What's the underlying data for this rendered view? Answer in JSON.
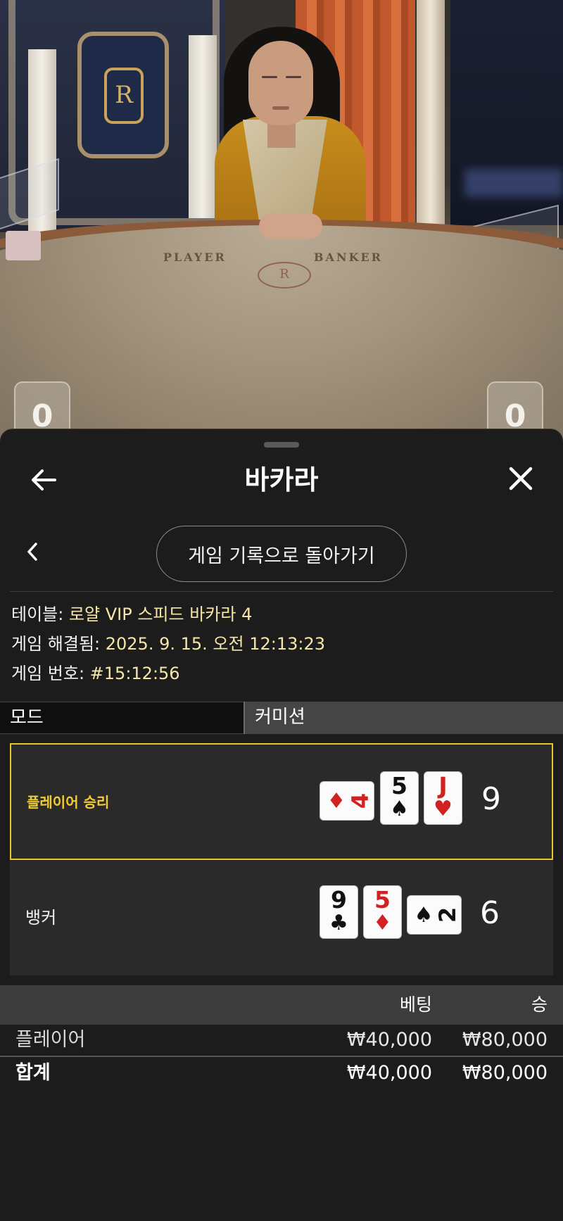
{
  "video": {
    "felt_player": "PLAYER",
    "felt_banker": "BANKER",
    "player_score": "0",
    "banker_score": "0"
  },
  "header": {
    "title": "바카라",
    "back_icon": "arrow-left-icon",
    "close_icon": "close-x-icon"
  },
  "nav": {
    "back_to_history": "게임 기록으로 돌아가기",
    "prev_icon": "chevron-left-icon"
  },
  "info": {
    "table_label": "테이블: ",
    "table_value": "로얄 VIP 스피드 바카라 4",
    "resolved_label": "게임 해결됨: ",
    "resolved_value": "2025. 9. 15. 오전 12:13:23",
    "number_label": "게임 번호: ",
    "number_value": "#15:12:56"
  },
  "tabs": {
    "mode": "모드",
    "commission": "커미션"
  },
  "results": {
    "player": {
      "label": "플레이어 승리",
      "score": "9",
      "cards": [
        {
          "rank": "4",
          "suit": "♦",
          "color": "#d12222",
          "orientation": "sideways"
        },
        {
          "rank": "5",
          "suit": "♠",
          "color": "#111111",
          "orientation": "upright"
        },
        {
          "rank": "J",
          "suit": "♥",
          "color": "#d12222",
          "orientation": "upright"
        }
      ]
    },
    "banker": {
      "label": "뱅커",
      "score": "6",
      "cards": [
        {
          "rank": "9",
          "suit": "♣",
          "color": "#111111",
          "orientation": "upright"
        },
        {
          "rank": "5",
          "suit": "♦",
          "color": "#d12222",
          "orientation": "upright"
        },
        {
          "rank": "2",
          "suit": "♠",
          "color": "#111111",
          "orientation": "sideways"
        }
      ]
    },
    "win_highlight_color": "#e6c62a"
  },
  "bets": {
    "col_bet": "베팅",
    "col_win": "승",
    "rows": [
      {
        "name": "플레이어",
        "bet": "₩40,000",
        "win": "₩80,000"
      }
    ],
    "total": {
      "name": "합계",
      "bet": "₩40,000",
      "win": "₩80,000"
    }
  }
}
